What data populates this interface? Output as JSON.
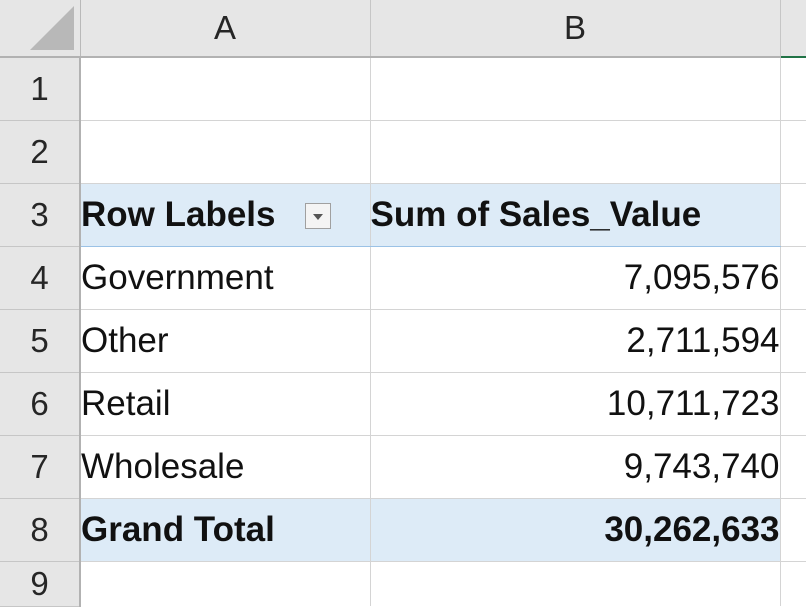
{
  "columns": {
    "a": "A",
    "b": "B"
  },
  "rows": [
    {
      "num": "1",
      "a": "",
      "b": ""
    },
    {
      "num": "2",
      "a": "",
      "b": ""
    },
    {
      "num": "3",
      "a": "Row Labels",
      "b": "Sum of Sales_Value"
    },
    {
      "num": "4",
      "a": "Government",
      "b": "7,095,576"
    },
    {
      "num": "5",
      "a": "Other",
      "b": "2,711,594"
    },
    {
      "num": "6",
      "a": "Retail",
      "b": "10,711,723"
    },
    {
      "num": "7",
      "a": "Wholesale",
      "b": "9,743,740"
    },
    {
      "num": "8",
      "a": "Grand Total",
      "b": "30,262,633"
    },
    {
      "num": "9",
      "a": "",
      "b": ""
    }
  ],
  "icons": {
    "filter": "dropdown-arrow-icon",
    "corner": "select-all-triangle-icon"
  },
  "colors": {
    "pivot_header_fill": "#ddebf7",
    "pivot_border": "#9bc2e6",
    "header_fill": "#e6e6e6"
  }
}
